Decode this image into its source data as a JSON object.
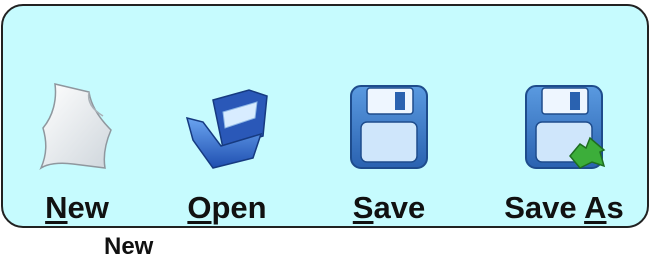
{
  "toolbar": {
    "buttons": [
      {
        "mnemonic": "N",
        "rest": "ew",
        "icon": "new-document-icon"
      },
      {
        "mnemonic": "O",
        "rest": "pen",
        "icon": "open-folder-icon"
      },
      {
        "mnemonic": "S",
        "rest": "ave",
        "icon": "save-disk-icon"
      },
      {
        "pre": "Save ",
        "mnemonic": "A",
        "rest": "s",
        "icon": "save-as-disk-icon"
      }
    ]
  },
  "tooltip": {
    "text": "New"
  },
  "colors": {
    "toolbar_bg": "#c6fbfe",
    "disk_blue": "#3a78c8",
    "folder_blue": "#2f63c4",
    "arrow_green": "#3cae3a"
  }
}
